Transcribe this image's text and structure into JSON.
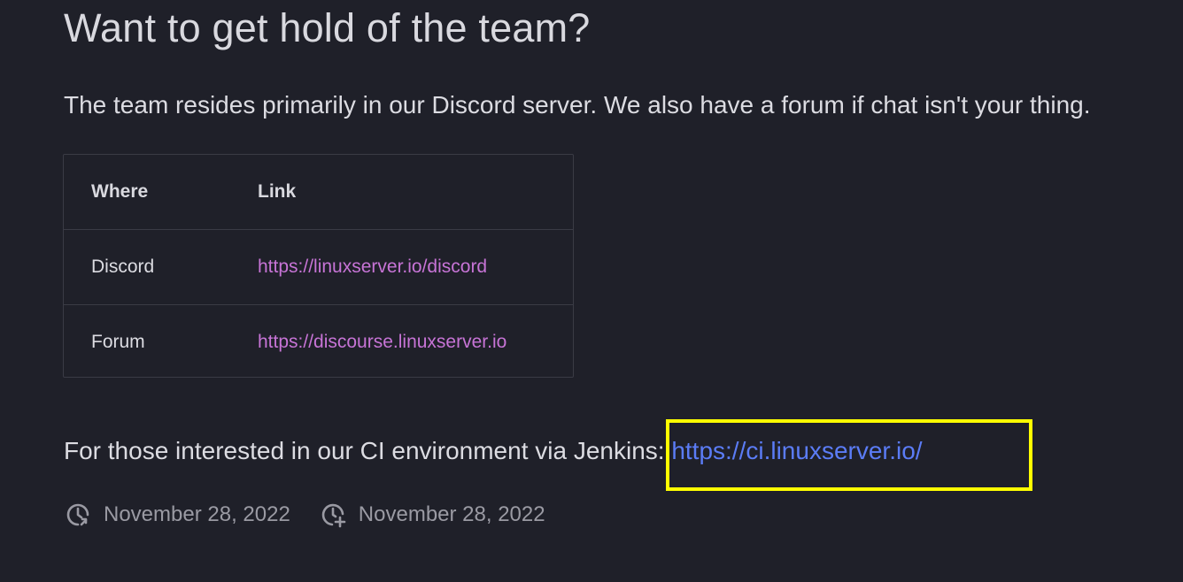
{
  "heading": "Want to get hold of the team?",
  "intro": "The team resides primarily in our Discord server. We also have a forum if chat isn't your thing.",
  "table": {
    "headers": [
      "Where",
      "Link"
    ],
    "rows": [
      {
        "where": "Discord",
        "link": "https://linuxserver.io/discord"
      },
      {
        "where": "Forum",
        "link": "https://discourse.linuxserver.io"
      }
    ]
  },
  "ci": {
    "text": "For those interested in our CI environment via Jenkins: ",
    "link": "https://ci.linuxserver.io/"
  },
  "meta": {
    "updated_icon": "clock-update-icon",
    "updated_date": "November 28, 2022",
    "created_icon": "clock-plus-icon",
    "created_date": "November 28, 2022"
  },
  "colors": {
    "background": "#1f2029",
    "visited_link": "#c774d6",
    "link": "#5b7cf6",
    "highlight": "#ffff00"
  }
}
